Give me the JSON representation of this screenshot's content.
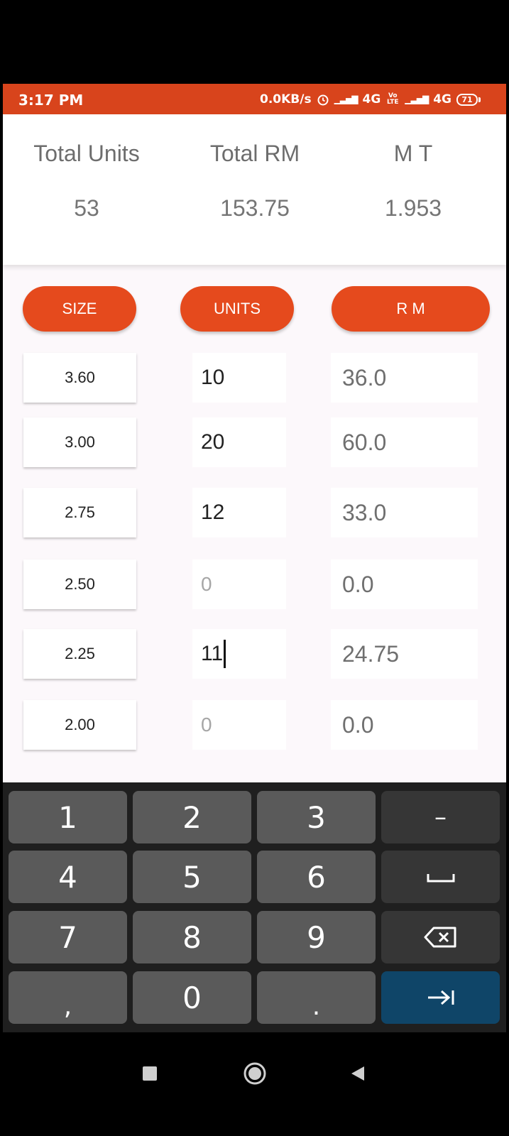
{
  "status_bar": {
    "time": "3:17 PM",
    "network_speed": "0.0KB/s",
    "network1": "4G",
    "volte": "Vo LTE",
    "network2": "4G",
    "battery": "71"
  },
  "summary": {
    "total_units_label": "Total Units",
    "total_rm_label": "Total RM",
    "mt_label": "M T",
    "total_units_value": "53",
    "total_rm_value": "153.75",
    "mt_value": "1.953"
  },
  "headers": {
    "size": "SIZE",
    "units": "UNITS",
    "rm": "R M"
  },
  "rows": [
    {
      "size": "3.60",
      "units": "10",
      "rm": "36.0"
    },
    {
      "size": "3.00",
      "units": "20",
      "rm": "60.0"
    },
    {
      "size": "2.75",
      "units": "12",
      "rm": "33.0"
    },
    {
      "size": "2.50",
      "units": "0",
      "rm": "0.0"
    },
    {
      "size": "2.25",
      "units": "11",
      "rm": "24.75"
    },
    {
      "size": "2.00",
      "units": "0",
      "rm": "0.0"
    }
  ],
  "keyboard": {
    "k1": "1",
    "k2": "2",
    "k3": "3",
    "minus": "–",
    "k4": "4",
    "k5": "5",
    "k6": "6",
    "space": "␣",
    "k7": "7",
    "k8": "8",
    "k9": "9",
    "backspace": "⌫",
    "comma": ",",
    "k0": "0",
    "dot": ".",
    "next": "→|"
  },
  "colors": {
    "accent": "#e54a1d",
    "status_bar": "#d8441c",
    "keyboard_enter": "#0f4568"
  }
}
